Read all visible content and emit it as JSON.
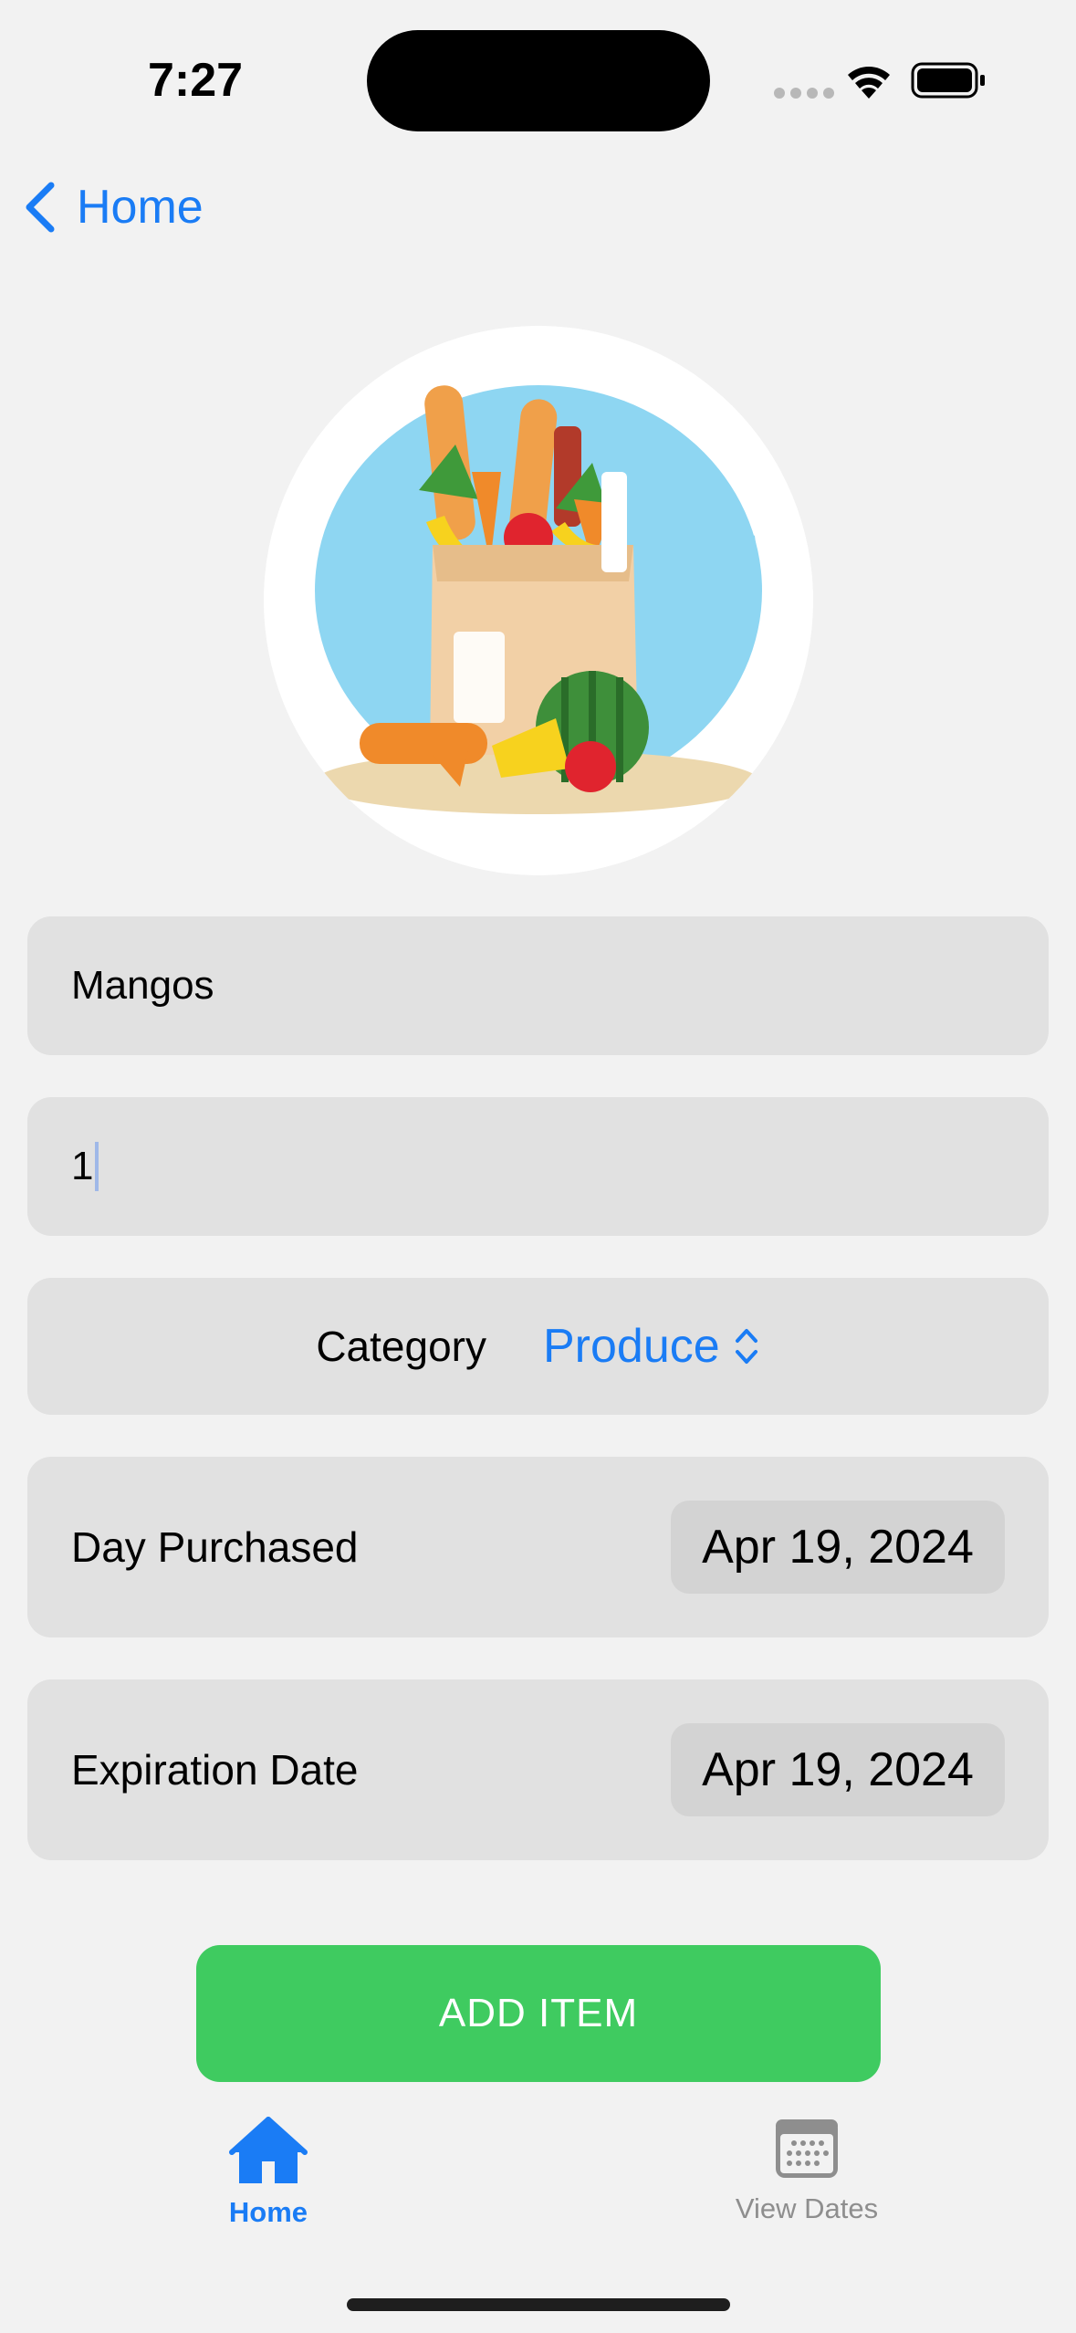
{
  "status_bar": {
    "time": "7:27"
  },
  "nav": {
    "back_label": "Home"
  },
  "form": {
    "name_value": "Mangos",
    "quantity_value": "1",
    "category_label": "Category",
    "category_value": "Produce",
    "day_purchased_label": "Day Purchased",
    "day_purchased_value": "Apr 19, 2024",
    "expiration_label": "Expiration Date",
    "expiration_value": "Apr 19, 2024",
    "add_button_label": "ADD ITEM"
  },
  "tab_bar": {
    "home_label": "Home",
    "dates_label": "View Dates",
    "active_tab": "Home"
  },
  "colors": {
    "accent": "#1a7cf5",
    "button_green": "#3fcb60",
    "field_bg": "#e1e1e1",
    "background": "#f2f2f2"
  },
  "icons": {
    "back": "chevron-left-icon",
    "category_picker": "chevron-up-down-icon",
    "home_tab": "house-icon",
    "dates_tab": "calendar-icon"
  }
}
